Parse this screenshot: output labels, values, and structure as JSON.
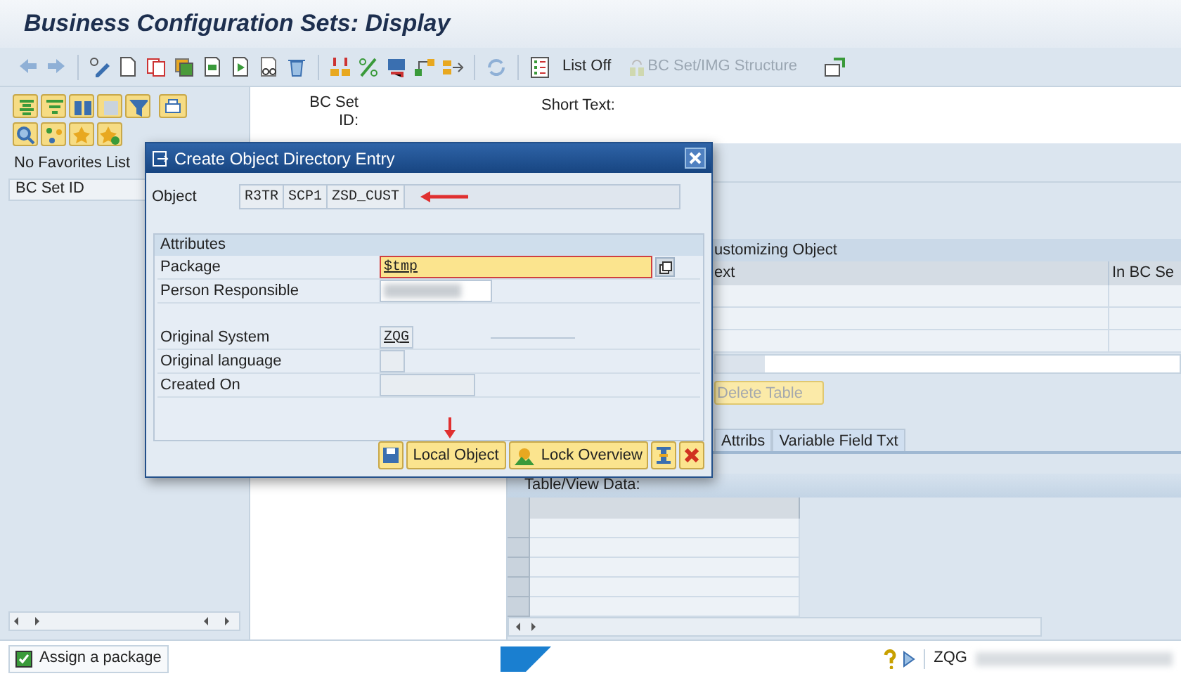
{
  "window": {
    "title": "Business Configuration Sets: Display"
  },
  "toolbar": {
    "buttons": [
      {
        "label": "List Off",
        "disabled": false
      },
      {
        "label": "BC Set/IMG Structure",
        "disabled": true
      }
    ]
  },
  "left_panel": {
    "favorites_label": "No Favorites List",
    "column": "BC Set ID"
  },
  "header": {
    "fields": [
      {
        "label": "BC Set ID:"
      },
      {
        "label": "Short Text:"
      }
    ]
  },
  "customizing_object": {
    "title": "ustomizing Object",
    "columns": [
      "ext",
      "In BC Se"
    ],
    "delete_button": {
      "label": "Delete Table",
      "disabled": true
    }
  },
  "tabs": [
    {
      "label": "Attribs",
      "selected": false
    },
    {
      "label": "Variable Field Txt",
      "selected": false
    }
  ],
  "table_view": {
    "title": "Table/View Data:"
  },
  "dialog": {
    "title": "Create Object Directory Entry",
    "object": {
      "label": "Object",
      "parts": [
        "R3TR",
        "SCP1",
        "ZSD_CUST"
      ]
    },
    "group": "Attributes",
    "fields": [
      {
        "label": "Package",
        "kind": "input",
        "value": "$tmp",
        "focused": true,
        "value_help": true
      },
      {
        "label": "Person Responsible",
        "kind": "redacted",
        "focused": false,
        "value_help": false
      }
    ],
    "origin_fields": [
      {
        "label": "Original System",
        "kind": "display",
        "value": "ZQG",
        "focused": false,
        "value_help": false
      },
      {
        "label": "Original language",
        "kind": "display_short",
        "focused": false,
        "value_help": false
      },
      {
        "label": "Created On",
        "kind": "display",
        "focused": false,
        "value_help": false
      }
    ],
    "buttons": [
      {
        "kind": "save"
      },
      {
        "kind": "text",
        "label": "Local Object"
      },
      {
        "kind": "lock",
        "label": "Lock Overview"
      },
      {
        "kind": "return"
      },
      {
        "kind": "cancel"
      }
    ]
  },
  "status_bar": {
    "message": "Assign a package",
    "system": "ZQG"
  }
}
